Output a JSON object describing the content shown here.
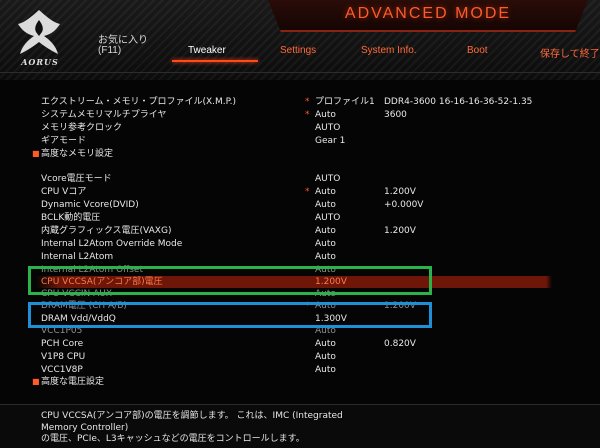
{
  "header": {
    "brand": "AORUS",
    "mode_title": "ADVANCED MODE",
    "favorites_label": "お気に入り",
    "favorites_key": "(F11)",
    "tabs": {
      "tweaker": "Tweaker",
      "settings": "Settings",
      "sysinfo": "System Info.",
      "boot": "Boot",
      "save_exit": "保存して終了"
    }
  },
  "settings": [
    {
      "label": "エクストリーム・メモリ・プロファイル(X.M.P.)",
      "star": "*",
      "value": "プロファイル1",
      "current": "DDR4-3600 16-16-16-36-52-1.35"
    },
    {
      "label": "システムメモリマルチプライヤ",
      "star": "*",
      "value": "Auto",
      "current": "3600"
    },
    {
      "label": "メモリ参考クロック",
      "value": "AUTO"
    },
    {
      "label": "ギアモード",
      "value": "Gear 1"
    },
    {
      "label": "高度なメモリ設定",
      "bullet": "■"
    },
    {
      "label": "Vcore電圧モード",
      "value": "AUTO"
    },
    {
      "label": "CPU Vコア",
      "star": "*",
      "value": "Auto",
      "current": "1.200V"
    },
    {
      "label": "Dynamic Vcore(DVID)",
      "value": "Auto",
      "current": "+0.000V"
    },
    {
      "label": "BCLK動的電圧",
      "value": "AUTO"
    },
    {
      "label": "内蔵グラフィックス電圧(VAXG)",
      "value": "Auto",
      "current": "1.200V"
    },
    {
      "label": "Internal L2Atom Override Mode",
      "value": "Auto"
    },
    {
      "label": "Internal L2Atom",
      "value": "Auto"
    },
    {
      "label": "Internal L2Atom Offset",
      "value": "Auto"
    },
    {
      "label": "CPU VCCSA(アンコア部)電圧",
      "value": "1.200V"
    },
    {
      "label": "CPU VCCIN AUX",
      "value": "Auto"
    },
    {
      "label": "DRAM電圧 (CH A/B)",
      "star": "*",
      "value": "Auto",
      "current": "1.200V"
    },
    {
      "label": "DRAM Vdd/VddQ",
      "value": "1.300V"
    },
    {
      "label": "VCC1P05",
      "value": "Auto"
    },
    {
      "label": "PCH Core",
      "value": "Auto",
      "current": "0.820V"
    },
    {
      "label": "V1P8 CPU",
      "value": "Auto"
    },
    {
      "label": "VCC1V8P",
      "value": "Auto"
    },
    {
      "label": "高度な電圧設定",
      "bullet": "■"
    }
  ],
  "help": {
    "line1": "CPU VCCSA(アンコア部)の電圧を調節します。 これは、IMC (Integrated",
    "line2": "Memory Controller)",
    "line3": "の電圧、PCIe、L3キャッシュなどの電圧をコントロールします。"
  },
  "colors": {
    "accent": "#ff5a2a",
    "selected_row": "#6e1608",
    "annotation_green": "#2bb24a",
    "annotation_blue": "#1f8fd8"
  }
}
